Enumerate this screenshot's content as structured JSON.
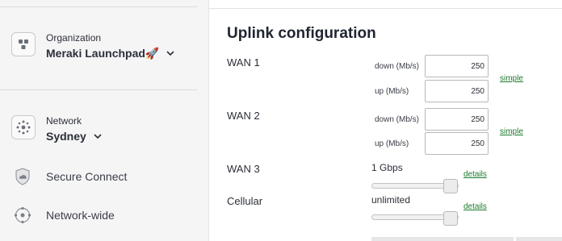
{
  "sidebar": {
    "organization": {
      "caption": "Organization",
      "name": "Meraki Launchpad🚀"
    },
    "network": {
      "caption": "Network",
      "name": "Sydney"
    },
    "items": [
      {
        "label": "Secure Connect",
        "icon": "cloud-shield-icon"
      },
      {
        "label": "Network-wide",
        "icon": "network-wide-icon"
      }
    ]
  },
  "main": {
    "title": "Uplink configuration",
    "wan1": {
      "label": "WAN 1",
      "down_label": "down (Mb/s)",
      "down_value": "250",
      "up_label": "up (Mb/s)",
      "up_value": "250",
      "link": "simple"
    },
    "wan2": {
      "label": "WAN 2",
      "down_label": "down (Mb/s)",
      "down_value": "250",
      "up_label": "up (Mb/s)",
      "up_value": "250",
      "link": "simple"
    },
    "wan3": {
      "label": "WAN 3",
      "speed": "1 Gbps",
      "link": "details",
      "slider_level": 1.0
    },
    "cellular": {
      "label": "Cellular",
      "speed": "unlimited",
      "link": "details",
      "slider_level": 1.0
    }
  },
  "colors": {
    "link": "#1c7a2c",
    "sidebar_bg": "#f5f5f6"
  }
}
